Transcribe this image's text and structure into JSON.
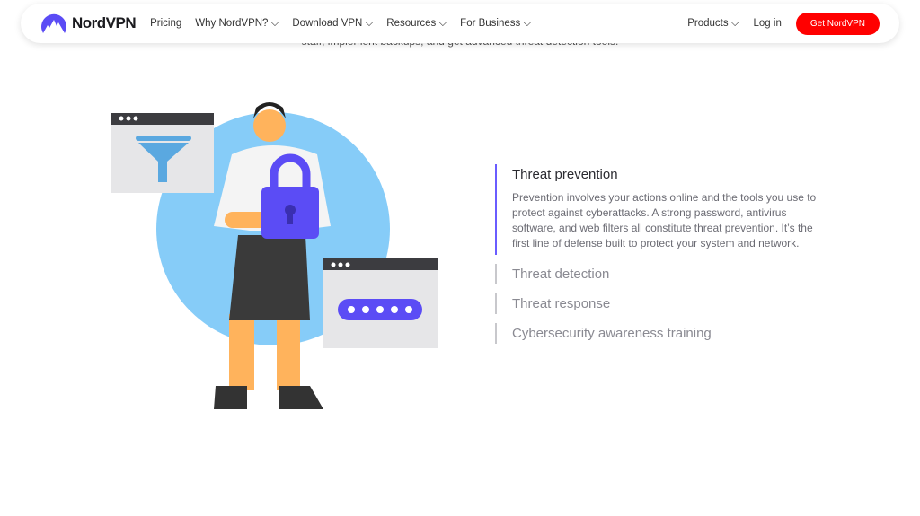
{
  "background_text": {
    "line2": "staff, implement backups, and get advanced threat detection tools."
  },
  "header": {
    "brand": "NordVPN",
    "nav": [
      {
        "label": "Pricing",
        "dropdown": false
      },
      {
        "label": "Why NordVPN?",
        "dropdown": true
      },
      {
        "label": "Download VPN",
        "dropdown": true
      },
      {
        "label": "Resources",
        "dropdown": true
      },
      {
        "label": "For Business",
        "dropdown": true
      }
    ],
    "products": "Products",
    "login": "Log in",
    "cta": "Get NordVPN"
  },
  "colors": {
    "accent": "#6a5cff",
    "cta": "#ff0000",
    "circle": "#86ccf8"
  },
  "sections": [
    {
      "title": "Threat prevention",
      "active": true,
      "body": "Prevention involves your actions online and the tools you use to protect against cyberattacks. A strong password, antivirus software, and web filters all constitute threat prevention. It’s the first line of defense built to protect your system and network."
    },
    {
      "title": "Threat detection",
      "active": false
    },
    {
      "title": "Threat response",
      "active": false
    },
    {
      "title": "Cybersecurity awareness training",
      "active": false
    }
  ]
}
